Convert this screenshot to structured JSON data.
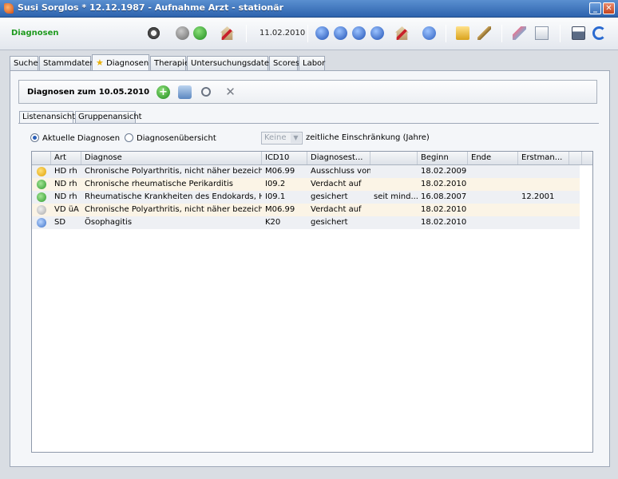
{
  "window": {
    "title": "Susi Sorglos  * 12.12.1987 - Aufnahme Arzt - stationär",
    "minimize_label": "_",
    "close_label": "✕"
  },
  "toolbar": {
    "section_label": "Diagnosen",
    "date": "11.02.2010",
    "icons": [
      "gear-icon",
      "back-icon",
      "forward-icon",
      "house-icon",
      "first-icon",
      "previous-icon",
      "next-icon",
      "last-icon",
      "house-icon",
      "info-icon",
      "folder-icon",
      "pen-icon",
      "eraser-icon",
      "copy-icon",
      "save-icon",
      "refresh-icon"
    ]
  },
  "main_tabs": [
    {
      "label": "Suche"
    },
    {
      "label": "Stammdaten"
    },
    {
      "label": "Diagnosen"
    },
    {
      "label": "Therapie"
    },
    {
      "label": "Untersuchungsdaten"
    },
    {
      "label": "Scores"
    },
    {
      "label": "Labor"
    }
  ],
  "header": {
    "heading": "Diagnosen zum 10.05.2010",
    "add_label": "+",
    "delete_label": "✕"
  },
  "sub_tabs": [
    {
      "label": "Listenansicht"
    },
    {
      "label": "Gruppenansicht"
    }
  ],
  "filters": {
    "current_label": "Aktuelle Diagnosen",
    "overview_label": "Diagnosenübersicht",
    "selected": "current",
    "restriction_value": "Keine",
    "combo_arrow": "▼",
    "restriction_label": "zeitliche Einschränkung (Jahre)"
  },
  "grid": {
    "columns": [
      "Art",
      "Diagnose",
      "ICD10",
      "Diagnosest...",
      "",
      "Beginn",
      "Ende",
      "Erstman..."
    ],
    "rows": [
      {
        "icon": "star-icon",
        "art": "HD rh",
        "diagnose": "Chronische Polyarthritis, nicht näher bezeichne...",
        "icd10": "M06.99",
        "status": "Ausschluss von",
        "extra": "",
        "beginn": "18.02.2009",
        "ende": "",
        "erstman": ""
      },
      {
        "icon": "green-dot-icon",
        "art": "ND rh",
        "diagnose": "Chronische rheumatische Perikarditis",
        "icd10": "I09.2",
        "status": "Verdacht auf",
        "extra": "",
        "beginn": "18.02.2010",
        "ende": "",
        "erstman": ""
      },
      {
        "icon": "green-dot-icon",
        "art": "ND rh",
        "diagnose": "Rheumatische Krankheiten des Endokards, Her...",
        "icd10": "I09.1",
        "status": "gesichert",
        "extra": "seit mind...",
        "beginn": "16.08.2007",
        "ende": "",
        "erstman": "12.2001"
      },
      {
        "icon": "grey-dot-icon",
        "art": "VD üA",
        "diagnose": "Chronische Polyarthritis, nicht näher bezeichne...",
        "icd10": "M06.99",
        "status": "Verdacht auf",
        "extra": "",
        "beginn": "18.02.2010",
        "ende": "",
        "erstman": ""
      },
      {
        "icon": "blue-dot-icon",
        "art": "SD",
        "diagnose": "Ösophagitis",
        "icd10": "K20",
        "status": "gesichert",
        "extra": "",
        "beginn": "18.02.2010",
        "ende": "",
        "erstman": ""
      }
    ]
  }
}
